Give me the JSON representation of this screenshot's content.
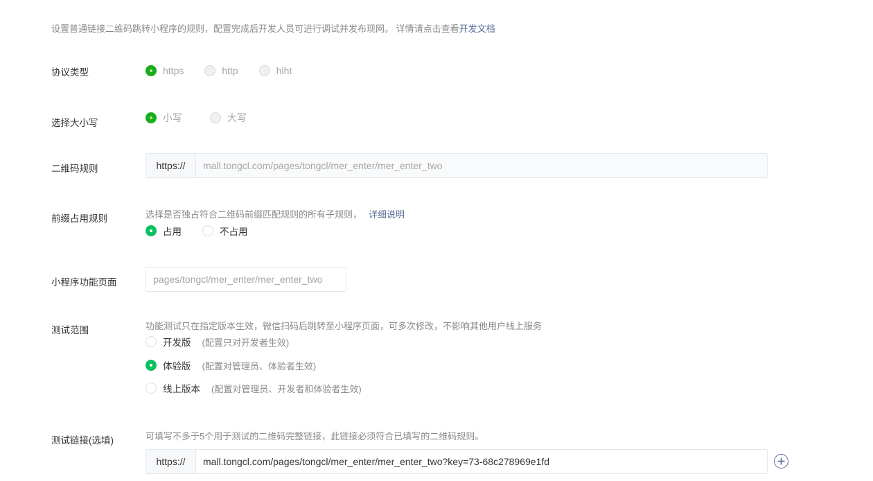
{
  "intro": {
    "text": "设置普通链接二维码跳转小程序的规则，配置完成后开发人员可进行调试并发布现网。 详情请点击查看",
    "link": "开发文档"
  },
  "protocol": {
    "label": "协议类型",
    "options": [
      "https",
      "http",
      "hlht"
    ],
    "selected": "https"
  },
  "case": {
    "label": "选择大小写",
    "options": [
      "小写",
      "大写"
    ],
    "selected": "小写"
  },
  "qr_rule": {
    "label": "二维码规则",
    "prefix": "https://",
    "value": "mall.tongcl.com/pages/tongcl/mer_enter/mer_enter_two"
  },
  "prefix_rule": {
    "label": "前缀占用规则",
    "hint": "选择是否独占符合二维码前缀匹配规则的所有子规则，",
    "hint_link": "详细说明",
    "options": [
      "占用",
      "不占用"
    ],
    "selected": "占用"
  },
  "mini_page": {
    "label": "小程序功能页面",
    "value": "pages/tongcl/mer_enter/mer_enter_two"
  },
  "test_scope": {
    "label": "测试范围",
    "hint": "功能测试只在指定版本生效，微信扫码后跳转至小程序页面，可多次修改，不影响其他用户线上服务",
    "options": [
      {
        "label": "开发版",
        "note": "(配置只对开发者生效)"
      },
      {
        "label": "体验版",
        "note": "(配置对管理员、体验者生效)"
      },
      {
        "label": "线上版本",
        "note": "(配置对管理员、开发者和体验者生效)"
      }
    ],
    "selected": "体验版"
  },
  "test_link": {
    "label": "测试链接(选填)",
    "hint": "可填写不多于5个用于测试的二维码完整链接，此链接必须符合已填写的二维码规则。",
    "prefix": "https://",
    "value": "mall.tongcl.com/pages/tongcl/mer_enter/mer_enter_two?key=73-68c278969e1fd",
    "add_icon": "plus-circle-icon"
  },
  "colors": {
    "accent_green": "#07c160",
    "link_blue": "#576b95"
  }
}
